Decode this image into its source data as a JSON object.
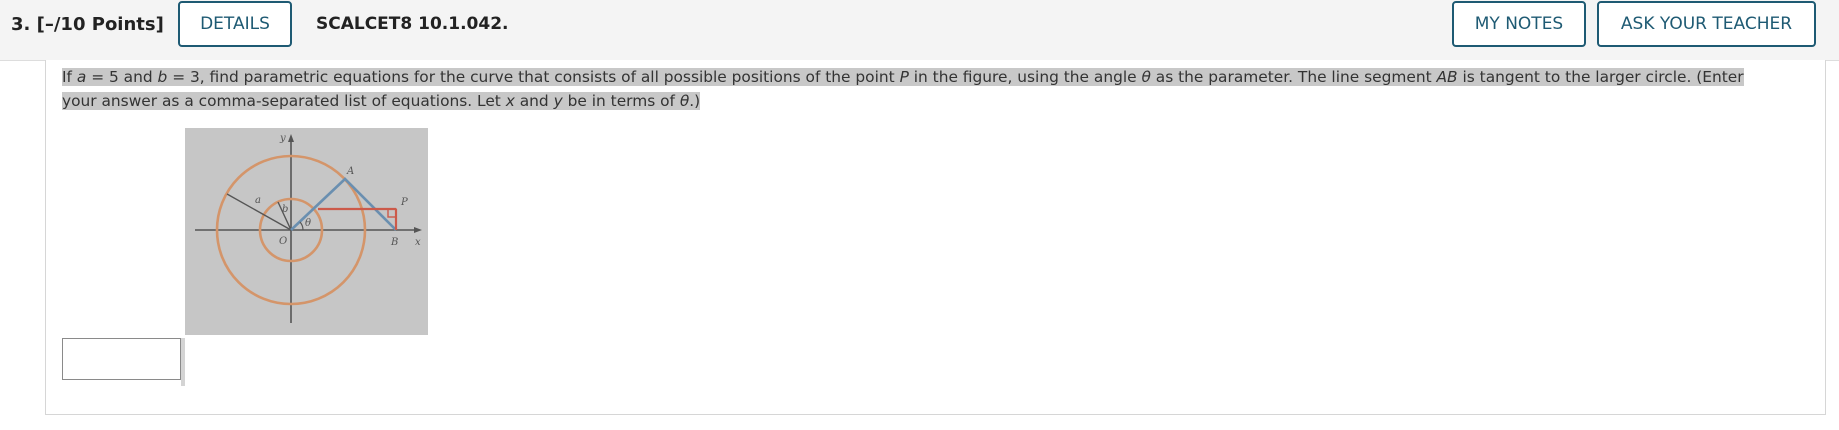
{
  "question": {
    "number_points": "3. [–/10 Points]",
    "details_label": "DETAILS",
    "code": "SCALCET8 10.1.042.",
    "my_notes_label": "MY NOTES",
    "ask_teacher_label": "ASK YOUR TEACHER"
  },
  "prompt": {
    "p1": "If ",
    "var_a": "a",
    "p2": " = 5 and ",
    "var_b": "b",
    "p3": " = 3, find parametric equations for the curve that consists of all possible positions of the point ",
    "var_P": "P",
    "p4": " in the figure, using the angle ",
    "var_theta": "θ",
    "p5": " as the parameter. The line segment ",
    "var_AB": "AB",
    "p6": " is tangent to the larger circle. (Enter your answer as a comma-separated list of equations. Let ",
    "var_x": "x",
    "p7": " and ",
    "var_y": "y",
    "p8": " be in terms of ",
    "var_theta2": "θ",
    "p9": ".)"
  },
  "figure": {
    "label_y": "y",
    "label_x": "x",
    "label_A": "A",
    "label_P": "P",
    "label_a": "a",
    "label_b": "b",
    "label_O": "O",
    "label_theta": "θ",
    "label_B": "B",
    "colors": {
      "circle": "#d4956a",
      "segment": "#6a8fb0",
      "p_lines": "#cc5a4a",
      "axes": "#555555"
    }
  },
  "answer": {
    "value": ""
  },
  "colors": {
    "accent": "#1e5a73",
    "highlight": "#c8c8c8"
  }
}
